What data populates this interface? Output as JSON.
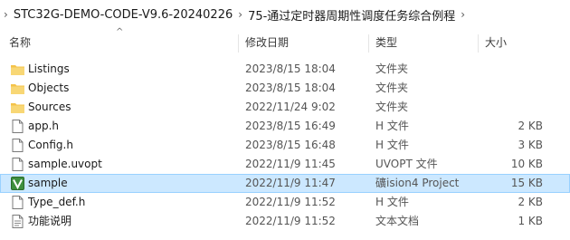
{
  "breadcrumb": [
    "STC32G-DEMO-CODE-V9.6-20240226",
    "75-通过定时器周期性调度任务综合例程"
  ],
  "columns": {
    "name": "名称",
    "date": "修改日期",
    "type": "类型",
    "size": "大小"
  },
  "sort_indicator": "^",
  "files": [
    {
      "name": "Listings",
      "date": "2023/8/15 18:04",
      "type": "文件夹",
      "size": "",
      "icon": "folder-icon"
    },
    {
      "name": "Objects",
      "date": "2023/8/15 18:04",
      "type": "文件夹",
      "size": "",
      "icon": "folder-icon"
    },
    {
      "name": "Sources",
      "date": "2022/11/24 9:02",
      "type": "文件夹",
      "size": "",
      "icon": "folder-icon"
    },
    {
      "name": "app.h",
      "date": "2023/8/15 16:49",
      "type": "H 文件",
      "size": "2 KB",
      "icon": "file-icon"
    },
    {
      "name": "Config.h",
      "date": "2023/8/15 16:48",
      "type": "H 文件",
      "size": "3 KB",
      "icon": "file-icon"
    },
    {
      "name": "sample.uvopt",
      "date": "2022/11/9 11:45",
      "type": "UVOPT 文件",
      "size": "10 KB",
      "icon": "file-icon"
    },
    {
      "name": "sample",
      "date": "2022/11/9 11:47",
      "type": "礦ision4 Project",
      "size": "15 KB",
      "icon": "uvision-project-icon",
      "selected": true
    },
    {
      "name": "Type_def.h",
      "date": "2022/11/9 11:52",
      "type": "H 文件",
      "size": "2 KB",
      "icon": "file-icon"
    },
    {
      "name": "功能说明",
      "date": "2022/11/9 11:52",
      "type": "文本文档",
      "size": "1 KB",
      "icon": "text-file-icon"
    }
  ],
  "colors": {
    "selection": "#cce8ff",
    "folder": "#f4c34a",
    "uvision": "#3e8f3e"
  }
}
